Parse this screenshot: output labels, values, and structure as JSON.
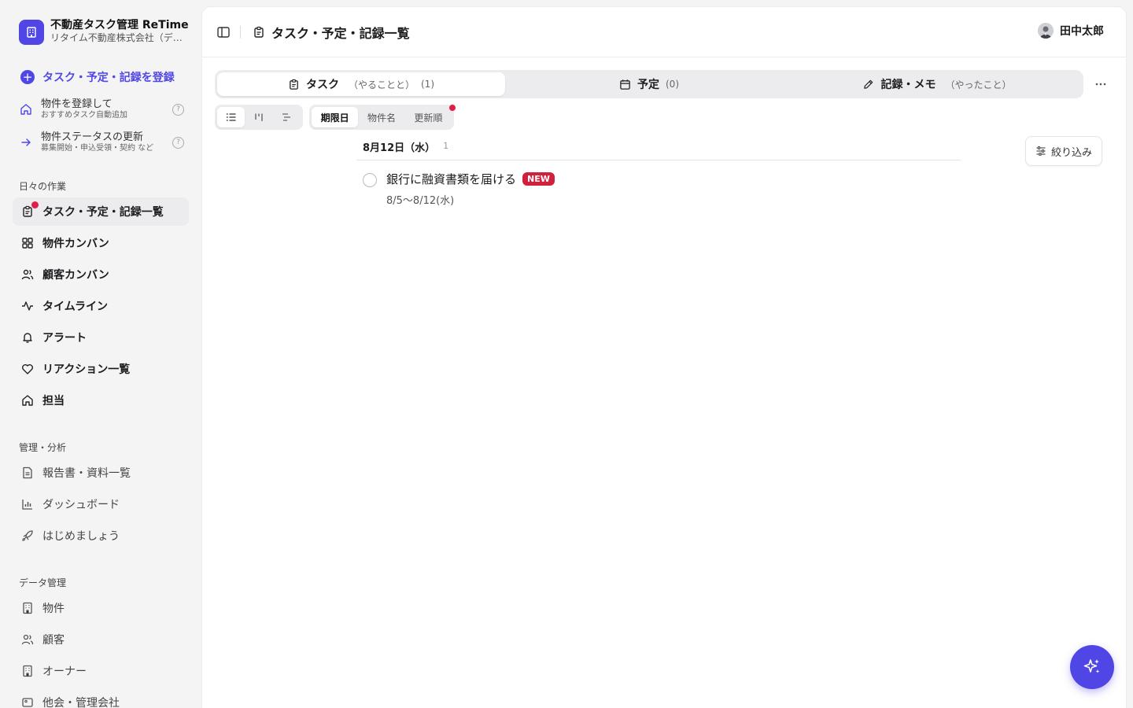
{
  "brand": {
    "title": "不動産タスク管理 ReTime",
    "subtitle": "リタイム不動産株式会社（デモ）"
  },
  "sidebar": {
    "register_label": "タスク・予定・記録を登録",
    "helpers": [
      {
        "title": "物件を登録して",
        "sub": "おすすめタスク自動追加"
      },
      {
        "title": "物件ステータスの更新",
        "sub": "募集開始・申込受領・契約 など"
      }
    ],
    "sections": {
      "daily": "日々の作業",
      "management": "管理・分析",
      "data": "データ管理"
    },
    "daily_items": [
      {
        "label": "タスク・予定・記録一覧",
        "icon": "clipboard-icon"
      },
      {
        "label": "物件カンバン",
        "icon": "grid-icon"
      },
      {
        "label": "顧客カンバン",
        "icon": "users-icon"
      },
      {
        "label": "タイムライン",
        "icon": "activity-icon"
      },
      {
        "label": "アラート",
        "icon": "bell-icon"
      },
      {
        "label": "リアクション一覧",
        "icon": "heart-icon"
      },
      {
        "label": "担当",
        "icon": "home-icon"
      }
    ],
    "management_items": [
      {
        "label": "報告書・資料一覧",
        "icon": "document-icon"
      },
      {
        "label": "ダッシュボード",
        "icon": "bar-chart-icon"
      },
      {
        "label": "はじめましょう",
        "icon": "rocket-icon"
      }
    ],
    "data_items": [
      {
        "label": "物件",
        "icon": "building-icon"
      },
      {
        "label": "顧客",
        "icon": "users-icon"
      },
      {
        "label": "オーナー",
        "icon": "building-icon"
      },
      {
        "label": "他会・管理会社",
        "icon": "image-icon"
      }
    ]
  },
  "header": {
    "title": "タスク・予定・記録一覧",
    "user_name": "田中太郎"
  },
  "tabs": [
    {
      "label": "タスク",
      "sub": "（やることと）",
      "count": "(1)"
    },
    {
      "label": "予定",
      "sub": "",
      "count": "(0)"
    },
    {
      "label": "記録・メモ",
      "sub": "（やったこと）",
      "count": ""
    }
  ],
  "sort_options": [
    "期限日",
    "物件名",
    "更新順"
  ],
  "filter_label": "絞り込み",
  "group": {
    "date": "8月12日（水）",
    "count": "1"
  },
  "tasks": [
    {
      "title": "銀行に融資書類を届ける",
      "badge": "NEW",
      "date_range": "8/5〜8/12(水)"
    }
  ],
  "colors": {
    "accent": "#5046e5",
    "badge": "#d21f3c",
    "dot": "#e11d48"
  }
}
